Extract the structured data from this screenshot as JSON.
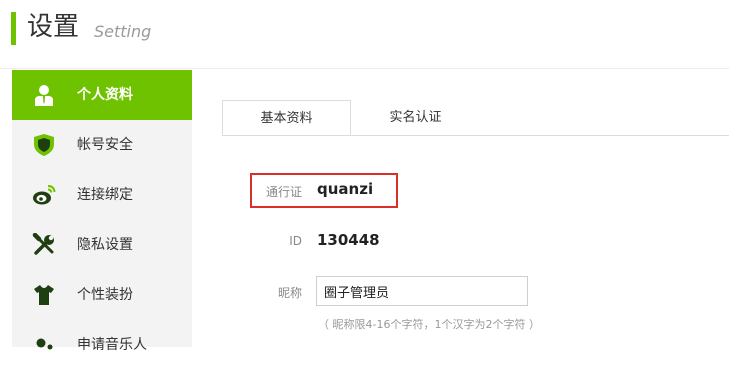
{
  "header": {
    "title": "设置",
    "subtitle": "Setting"
  },
  "sidebar": {
    "items": [
      {
        "label": "个人资料",
        "icon": "user-icon",
        "active": true
      },
      {
        "label": "帐号安全",
        "icon": "shield-icon",
        "active": false
      },
      {
        "label": "连接绑定",
        "icon": "weibo-icon",
        "active": false
      },
      {
        "label": "隐私设置",
        "icon": "tools-icon",
        "active": false
      },
      {
        "label": "个性装扮",
        "icon": "tshirt-icon",
        "active": false
      },
      {
        "label": "申请音乐人",
        "icon": "musician-icon",
        "active": false
      }
    ]
  },
  "tabs": [
    {
      "label": "基本资料",
      "active": true
    },
    {
      "label": "实名认证",
      "active": false
    }
  ],
  "form": {
    "passport_label": "通行证",
    "passport_value": "quanzi",
    "id_label": "ID",
    "id_value": "130448",
    "nickname_label": "昵称",
    "nickname_value": "圈子管理员",
    "nickname_hint": "（ 昵称限4-16个字符，1个汉字为2个字符 ）"
  },
  "colors": {
    "accent": "#6fc200",
    "highlight": "#d9302a"
  }
}
